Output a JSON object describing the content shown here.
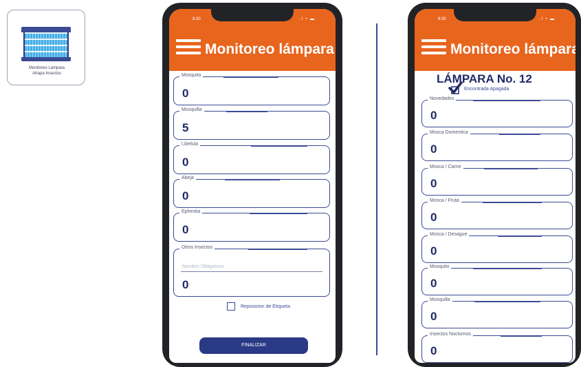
{
  "app_tile": {
    "label_line1": "Monitoreo Lámpara",
    "label_line2": "Atrapa Insectos"
  },
  "phone1": {
    "status_time": "8:30",
    "status_icons": "..l ≈ ▬",
    "title": "Monitoreo lámpara",
    "fields": [
      {
        "label": "Mosquito",
        "value": "0"
      },
      {
        "label": "Mosquilla",
        "value": "5"
      },
      {
        "label": "Libelula",
        "value": "0"
      },
      {
        "label": "Abeja",
        "value": "0"
      },
      {
        "label": "Ephestia",
        "value": "0"
      }
    ],
    "otros": {
      "label": "Otros Insectos",
      "placeholder": "Nombre Obligatorio",
      "value": "0"
    },
    "reposicion_label": "Reposicion de Etiqueta",
    "finalizar_label": "FINALIZAR"
  },
  "phone2": {
    "status_time": "8:30",
    "status_icons": "..l ≈ ▬",
    "title": "Monitoreo lámpara",
    "lamp_title": "LÁMPARA No. 12",
    "encontrada_label": "Encontrada Apagada",
    "fields": [
      {
        "label": "Novedades",
        "value": "0"
      },
      {
        "label": "Mosca Domestica",
        "value": "0"
      },
      {
        "label": "Mosca / Carne",
        "value": "0"
      },
      {
        "label": "Mosca / Fruta",
        "value": "0"
      },
      {
        "label": "Mosca / Desague",
        "value": "0"
      },
      {
        "label": "Mosquito",
        "value": "0"
      },
      {
        "label": "Mosquilla",
        "value": "0"
      },
      {
        "label": "Insectos Nocturnos",
        "value": "0"
      }
    ]
  },
  "colors": {
    "header_orange": "#e8651e",
    "navy": "#2b3a86",
    "field_border": "#3a4a94"
  }
}
